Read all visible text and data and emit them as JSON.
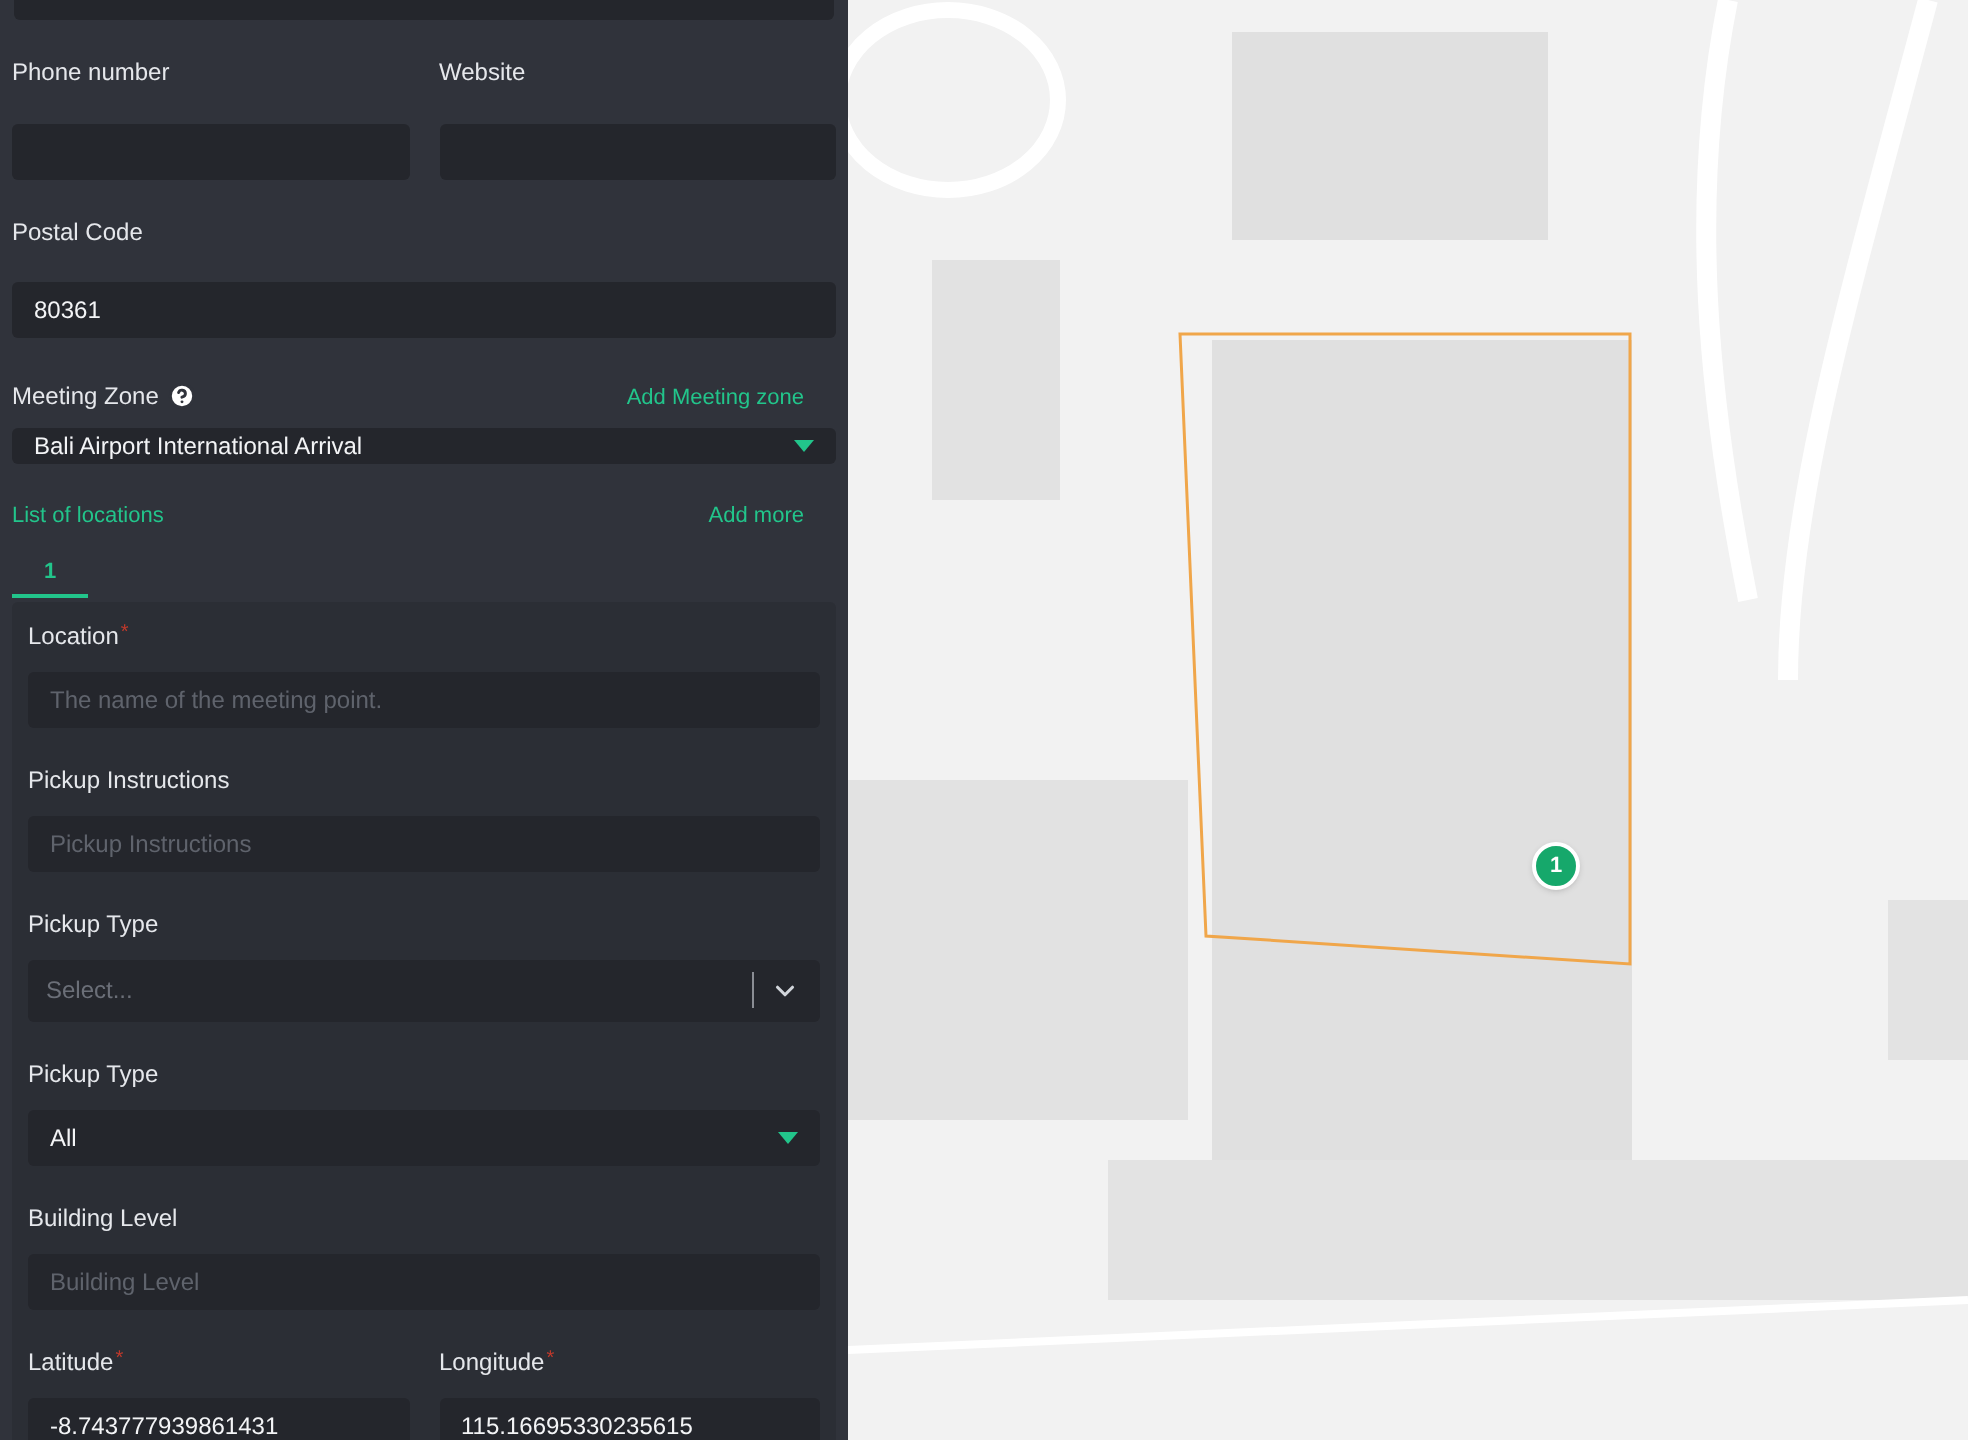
{
  "contact_fields": [
    {
      "label": "Phone number"
    },
    {
      "label": "Website"
    }
  ],
  "postal_code": {
    "label": "Postal Code",
    "value": "80361"
  },
  "meeting_zone": {
    "label": "Meeting Zone",
    "link": "Add Meeting zone",
    "value": "Bali Airport International Arrival"
  },
  "locations": {
    "title": "List of locations",
    "add_link": "Add more",
    "tabs": [
      {
        "label": "1",
        "selected": true
      }
    ]
  },
  "location_form": [
    {
      "kind": "input",
      "label": "Location",
      "required_mark": "*",
      "placeholder": "The name of the meeting point."
    },
    {
      "kind": "input",
      "label": "Pickup Instructions",
      "placeholder": "Pickup Instructions"
    },
    {
      "kind": "select",
      "label": "Pickup Type",
      "placeholder": "Select..."
    },
    {
      "kind": "dropdown",
      "label": "Pickup Type",
      "value": "All"
    },
    {
      "kind": "input",
      "label": "Building Level",
      "placeholder": "Building Level"
    }
  ],
  "coordinates": [
    {
      "label": "Latitude",
      "required_mark": "*",
      "value": "-8.743777939861431"
    },
    {
      "label": "Longitude",
      "required_mark": "*",
      "value": "115.16695330235615"
    }
  ],
  "map": {
    "marker": "1"
  }
}
